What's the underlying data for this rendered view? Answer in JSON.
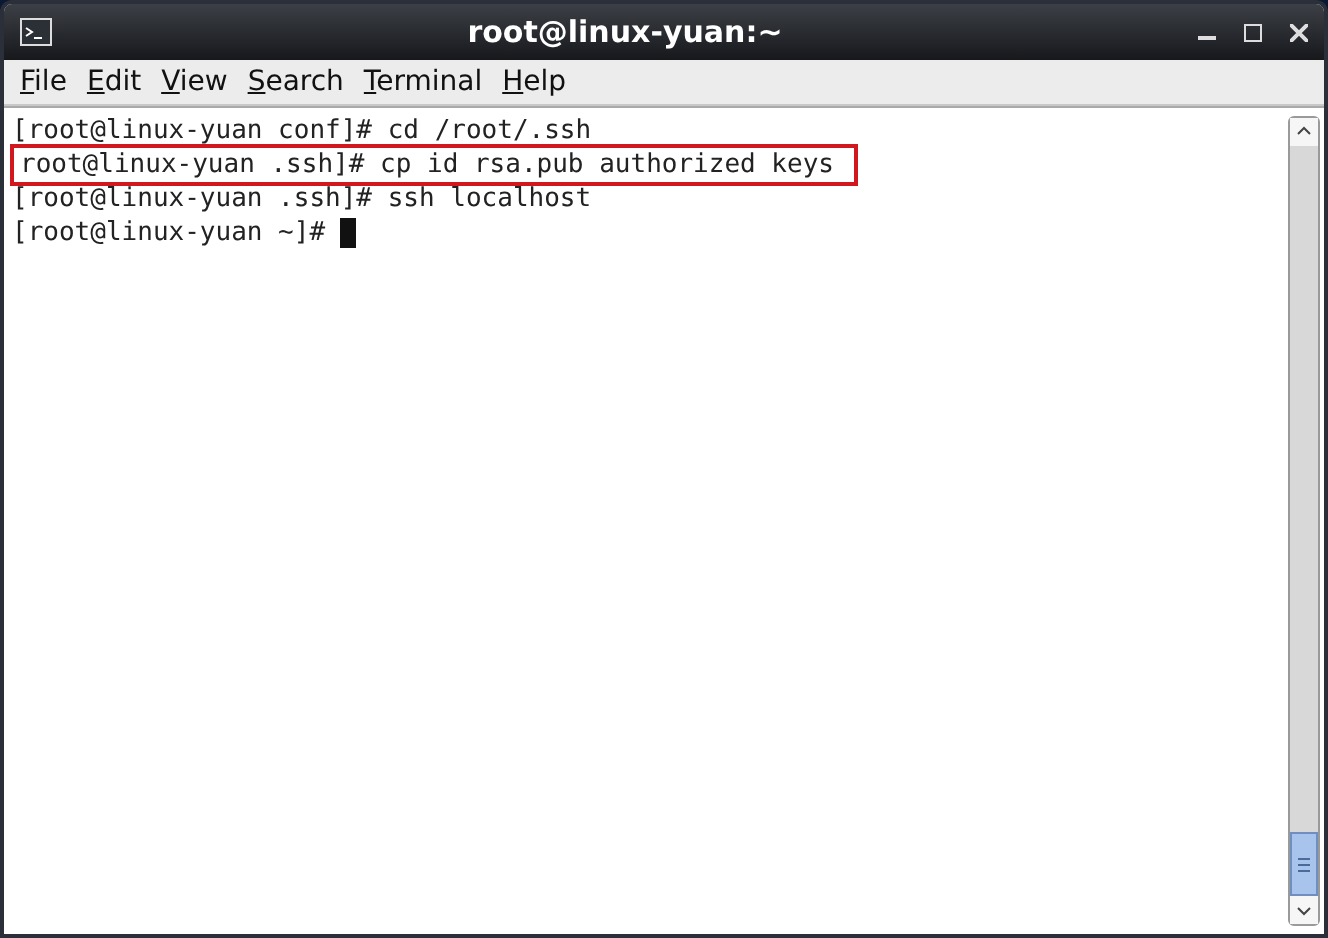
{
  "window": {
    "title": "root@linux-yuan:~"
  },
  "menu": [
    "File",
    "Edit",
    "View",
    "Search",
    "Terminal",
    "Help"
  ],
  "lines": [
    {
      "text": "[root@linux-yuan conf]# cd /root/.ssh",
      "highlighted": false,
      "cursor": false
    },
    {
      "text": "root@linux-yuan .ssh]# cp id rsa.pub authorized keys",
      "highlighted": true,
      "cursor": false
    },
    {
      "text": "[root@linux-yuan .ssh]# ssh localhost",
      "highlighted": false,
      "cursor": false
    },
    {
      "text": "[root@linux-yuan ~]# ",
      "highlighted": false,
      "cursor": true
    }
  ]
}
